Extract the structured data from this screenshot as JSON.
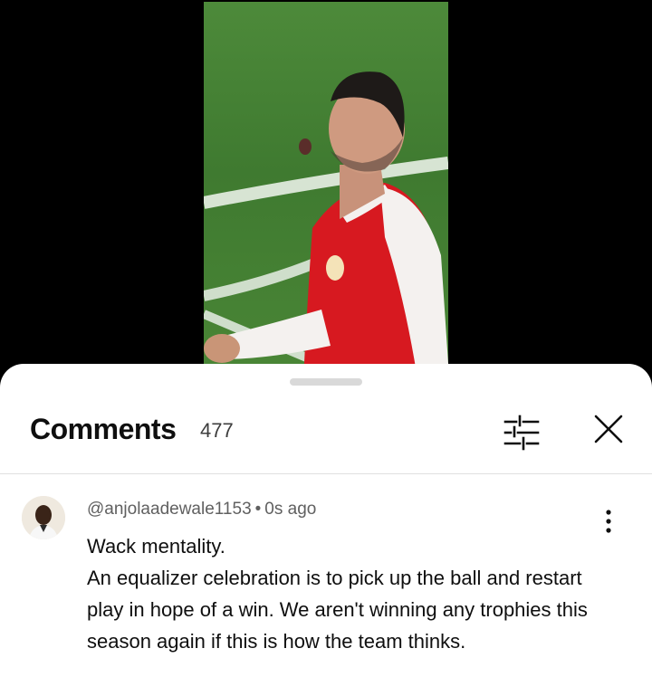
{
  "comments_panel": {
    "title": "Comments",
    "count": "477",
    "filter_icon": "sort-filter-icon",
    "close_icon": "close-icon"
  },
  "comment": {
    "author": "@anjolaadewale1153",
    "separator": "•",
    "time": "0s ago",
    "line1": "Wack mentality.",
    "line2": "An equalizer celebration is to pick up the ball and restart play in hope of a win. We aren't winning any trophies this season again if this is how the team thinks.",
    "more_icon": "more-vert-icon"
  },
  "colors": {
    "jersey_red": "#d71920",
    "pitch_green": "#4a8636",
    "text_primary": "#0f0f0f",
    "text_secondary": "#606060"
  }
}
